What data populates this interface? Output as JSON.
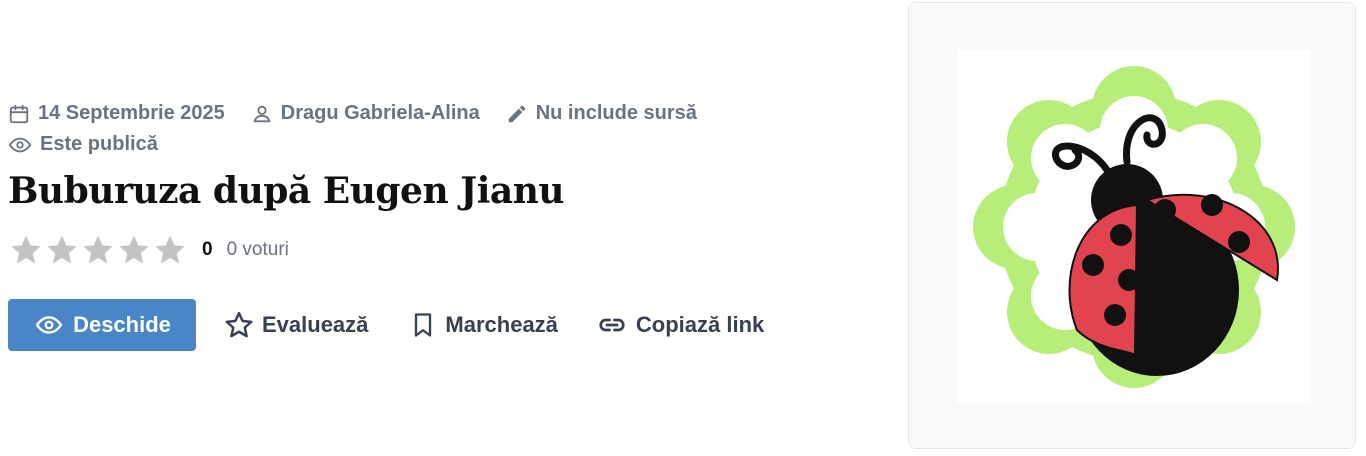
{
  "meta": {
    "date": "14 Septembrie 2025",
    "author": "Dragu Gabriela-Alina",
    "source": "Nu include sursă",
    "visibility": "Este publică",
    "icons": [
      "calendar-icon",
      "user-icon",
      "pencil-icon",
      "eye-icon"
    ]
  },
  "title": "Buburuza după Eugen Jianu",
  "rating": {
    "stars_filled": 0,
    "stars_total": 5,
    "count": "0",
    "votes": "0 voturi"
  },
  "actions": {
    "open": "Deschide",
    "rate": "Evaluează",
    "bookmark": "Marchează",
    "copy": "Copiază link"
  },
  "colors": {
    "primary": "#4a86c5",
    "meta_text": "#6b7280",
    "title_text": "#111111",
    "star_empty": "#c4c4c4"
  }
}
